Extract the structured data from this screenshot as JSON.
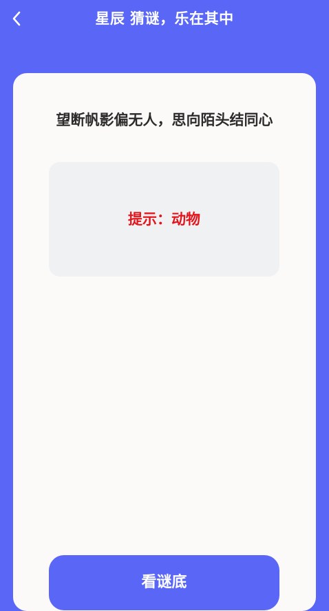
{
  "header": {
    "back_icon": "chevron-left-icon",
    "title": "星辰 猜谜，乐在其中"
  },
  "riddle": {
    "text": "望断帆影偏无人，思向陌头结同心",
    "hint": "提示：动物"
  },
  "watermark": "",
  "actions": {
    "reveal_answer_label": "看谜底"
  },
  "colors": {
    "background": "#5a67f6",
    "card": "#fcfaf8",
    "hint_box": "#f0f1f3",
    "hint_text": "#e3141b",
    "button": "#5a67f6"
  }
}
